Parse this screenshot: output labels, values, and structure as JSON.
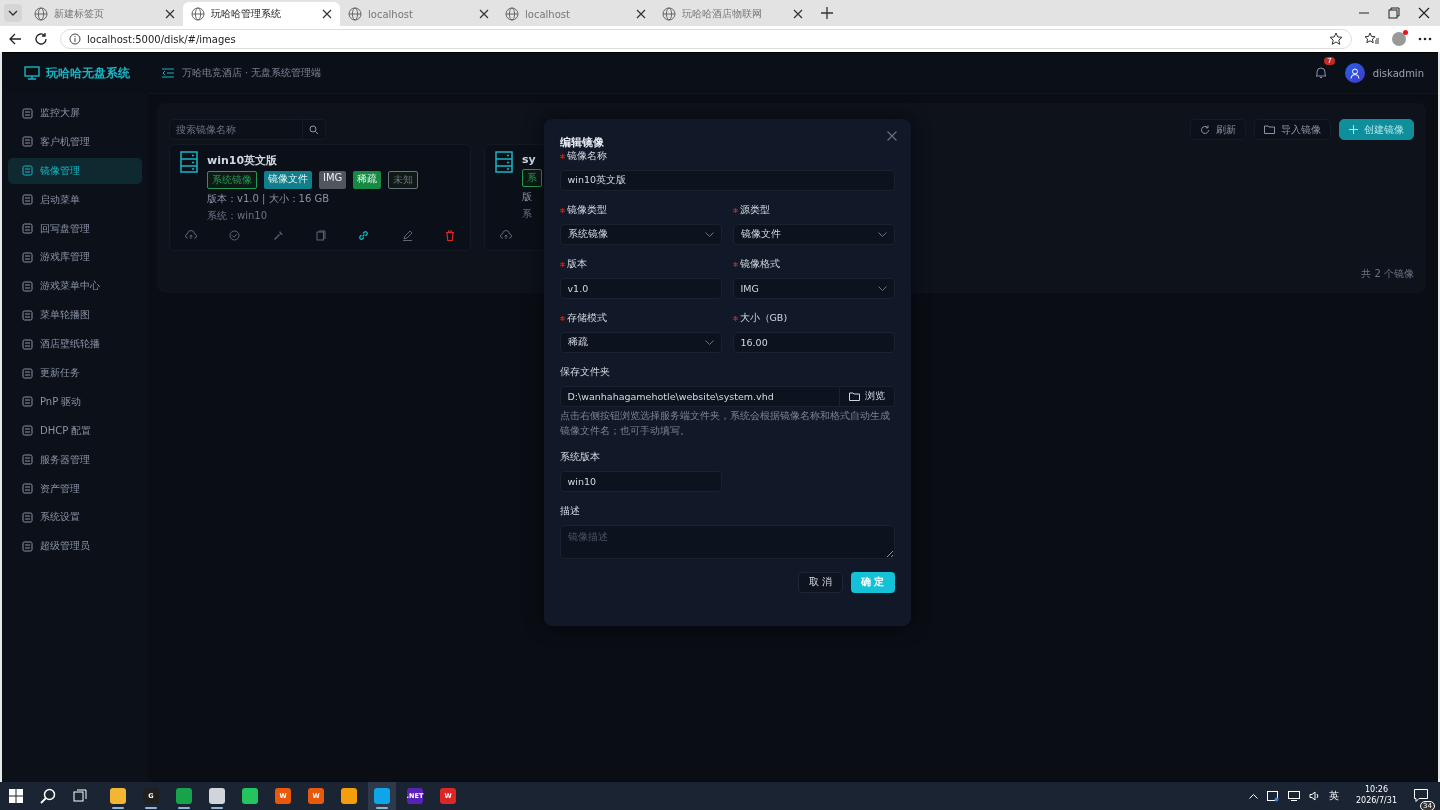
{
  "browser": {
    "tabs": [
      {
        "label": "新建标签页",
        "selected": false
      },
      {
        "label": "玩哈哈管理系统",
        "selected": true
      },
      {
        "label": "localhost",
        "selected": false
      },
      {
        "label": "localhost",
        "selected": false
      },
      {
        "label": "玩哈哈酒店物联网",
        "selected": false
      }
    ],
    "address": "localhost:5000/disk/#/images"
  },
  "sidebar": {
    "logo": "玩哈哈无盘系统",
    "items": [
      {
        "label": "监控大屏",
        "selected": false
      },
      {
        "label": "客户机管理",
        "selected": false
      },
      {
        "label": "镜像管理",
        "selected": true
      },
      {
        "label": "启动菜单",
        "selected": false
      },
      {
        "label": "回写盘管理",
        "selected": false
      },
      {
        "label": "游戏库管理",
        "selected": false
      },
      {
        "label": "游戏菜单中心",
        "selected": false
      },
      {
        "label": "菜单轮播图",
        "selected": false
      },
      {
        "label": "酒店壁纸轮播",
        "selected": false
      },
      {
        "label": "更新任务",
        "selected": false
      },
      {
        "label": "PnP 驱动",
        "selected": false
      },
      {
        "label": "DHCP 配置",
        "selected": false
      },
      {
        "label": "服务器管理",
        "selected": false
      },
      {
        "label": "资产管理",
        "selected": false
      },
      {
        "label": "系统设置",
        "selected": false
      },
      {
        "label": "超级管理员",
        "selected": false
      }
    ]
  },
  "header": {
    "breadcrumb": "万哈电竞酒店 · 无盘系统管理端",
    "notifications": "7",
    "user": "diskadmin"
  },
  "search": {
    "placeholder": "搜索镜像名称"
  },
  "toolbar": [
    {
      "label": "刷新",
      "kind": "refresh"
    },
    {
      "label": "导入镜像",
      "kind": "import"
    },
    {
      "label": "创建镜像",
      "kind": "create"
    }
  ],
  "cards": [
    {
      "title": "win10英文版",
      "tags": [
        {
          "label": "系统镜像",
          "color": "#1f9d55",
          "kind": "light"
        },
        {
          "label": "镜像文件",
          "color": "#0f7f8b",
          "kind": "solid"
        },
        {
          "label": "IMG",
          "color": "#50555e",
          "kind": "solid"
        },
        {
          "label": "稀疏",
          "color": "#168a40",
          "kind": "solid"
        },
        {
          "label": "未知",
          "color": "#6b7280",
          "kind": "light"
        }
      ],
      "meta": "版本：v1.0 | 大小：16 GB",
      "system": "系统：win10"
    },
    {
      "title": "sy",
      "tags": [
        {
          "label": "系",
          "color": "#1f9d55",
          "kind": "light"
        }
      ],
      "meta": "版",
      "system": "系"
    }
  ],
  "total": "共 2 个镜像",
  "dialog": {
    "title": "编辑镜像",
    "name": {
      "label": "镜像名称",
      "required": true,
      "value": "win10英文版"
    },
    "pairs": [
      [
        {
          "label": "镜像类型",
          "required": true,
          "kind": "select",
          "value": "系统镜像"
        },
        {
          "label": "源类型",
          "required": true,
          "kind": "select",
          "value": "镜像文件"
        }
      ],
      [
        {
          "label": "版本",
          "required": true,
          "kind": "input",
          "value": "v1.0"
        },
        {
          "label": "镜像格式",
          "required": true,
          "kind": "select",
          "value": "IMG"
        }
      ],
      [
        {
          "label": "存储模式",
          "required": true,
          "kind": "select",
          "value": "稀疏"
        },
        {
          "label": "大小（GB)",
          "required": true,
          "kind": "input",
          "value": "16.00"
        }
      ]
    ],
    "folder": {
      "label": "保存文件夹",
      "value": "D:\\wanhahagamehotle\\website\\system.vhd",
      "button": "浏览",
      "hint": "点击右侧按钮浏览选择服务端文件夹，系统会根据镜像名称和格式自动生成镜像文件名；也可手动填写。"
    },
    "system_version": {
      "label": "系统版本",
      "value": "win10"
    },
    "description": {
      "label": "描述",
      "placeholder": "镜像描述"
    },
    "cancel": "取 消",
    "confirm": "确 定"
  },
  "taskbar": {
    "apps": [
      {
        "color": "#f2b632",
        "running": true,
        "selected": false
      },
      {
        "color": "#1f1f1f",
        "label": "G",
        "running": true,
        "selected": false
      },
      {
        "color": "#16a34a",
        "running": true,
        "selected": false
      },
      {
        "color": "#d1d5db",
        "running": true,
        "selected": false
      },
      {
        "color": "#22c55e",
        "running": false,
        "selected": false
      },
      {
        "color": "#e8590c",
        "label": "W",
        "running": false,
        "selected": false
      },
      {
        "color": "#e8590c",
        "label": "W",
        "running": false,
        "selected": false
      },
      {
        "color": "#f59e0b",
        "running": false,
        "selected": false
      },
      {
        "color": "#0ea5e9",
        "running": true,
        "selected": true
      },
      {
        "color": "#5b21b6",
        "label": ".NET",
        "running": false,
        "selected": false
      },
      {
        "color": "#dc2626",
        "label": "W",
        "running": false,
        "selected": false
      }
    ],
    "ime": "英",
    "time": "10:26",
    "date": "2026/7/31",
    "notifications": "34"
  }
}
